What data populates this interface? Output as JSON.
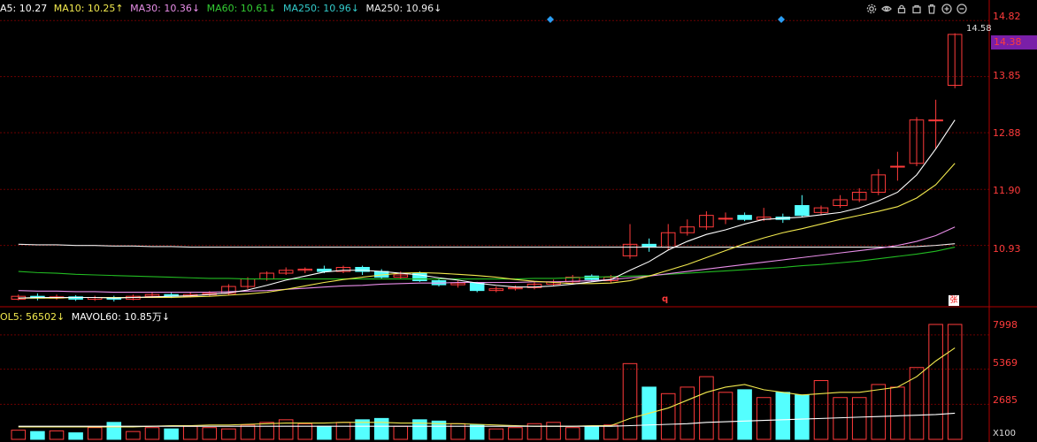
{
  "ma_legend": [
    {
      "label": "A5: 10.27",
      "color": "#ffffff"
    },
    {
      "label": "MA10: 10.25↑",
      "color": "#f2e94e"
    },
    {
      "label": "MA30: 10.36↓",
      "color": "#e88ee8"
    },
    {
      "label": "MA60: 10.61↓",
      "color": "#33cc33"
    },
    {
      "label": "MA250: 10.96↓",
      "color": "#33cccc"
    },
    {
      "label": "MA250: 10.96↓",
      "color": "#eeeeee"
    }
  ],
  "vol_legend": [
    {
      "label": "OL5: 56502↓",
      "color": "#f2e94e"
    },
    {
      "label": "MAVOL60: 10.85万↓",
      "color": "#ffffff"
    }
  ],
  "toolbar_icons": [
    "settings-icon",
    "eye-icon",
    "lock-icon",
    "bag-icon",
    "trash-icon",
    "zoom-in-icon",
    "zoom-out-icon"
  ],
  "price_axis": [
    "14.82",
    "13.85",
    "12.88",
    "11.90",
    "10.93"
  ],
  "current_price": "14.38",
  "high_label": "14.58",
  "volume_axis": [
    "7998",
    "5369",
    "2685"
  ],
  "volume_unit": "X100",
  "marker_q": "q",
  "badge_text": "张",
  "colors": {
    "up": "#ff3b3b",
    "down": "#54ffff",
    "grid": "#6b0000"
  },
  "chart_data": {
    "type": "candlestick",
    "ylim": [
      9.9,
      14.9
    ],
    "candles": [
      [
        10.0,
        10.05,
        10.08,
        9.98
      ],
      [
        10.05,
        10.02,
        10.1,
        9.98
      ],
      [
        10.02,
        10.04,
        10.08,
        9.99
      ],
      [
        10.04,
        10.0,
        10.07,
        9.97
      ],
      [
        10.0,
        10.03,
        10.06,
        9.97
      ],
      [
        10.03,
        10.0,
        10.06,
        9.96
      ],
      [
        10.0,
        10.05,
        10.08,
        9.98
      ],
      [
        10.05,
        10.08,
        10.12,
        10.02
      ],
      [
        10.08,
        10.05,
        10.11,
        10.02
      ],
      [
        10.05,
        10.08,
        10.12,
        10.03
      ],
      [
        10.08,
        10.1,
        10.14,
        10.05
      ],
      [
        10.1,
        10.22,
        10.26,
        10.07
      ],
      [
        10.22,
        10.35,
        10.38,
        10.18
      ],
      [
        10.35,
        10.45,
        10.48,
        10.32
      ],
      [
        10.45,
        10.5,
        10.55,
        10.42
      ],
      [
        10.5,
        10.52,
        10.55,
        10.45
      ],
      [
        10.52,
        10.48,
        10.58,
        10.45
      ],
      [
        10.48,
        10.55,
        10.58,
        10.45
      ],
      [
        10.55,
        10.48,
        10.58,
        10.42
      ],
      [
        10.48,
        10.38,
        10.52,
        10.35
      ],
      [
        10.38,
        10.42,
        10.48,
        10.35
      ],
      [
        10.45,
        10.32,
        10.48,
        10.3
      ],
      [
        10.32,
        10.25,
        10.35,
        10.22
      ],
      [
        10.25,
        10.28,
        10.32,
        10.2
      ],
      [
        10.28,
        10.15,
        10.3,
        10.12
      ],
      [
        10.15,
        10.18,
        10.22,
        10.12
      ],
      [
        10.18,
        10.2,
        10.24,
        10.15
      ],
      [
        10.2,
        10.26,
        10.3,
        10.17
      ],
      [
        10.26,
        10.3,
        10.34,
        10.22
      ],
      [
        10.3,
        10.38,
        10.42,
        10.26
      ],
      [
        10.4,
        10.34,
        10.43,
        10.3
      ],
      [
        10.32,
        10.38,
        10.42,
        10.28
      ],
      [
        10.75,
        10.95,
        11.3,
        10.7
      ],
      [
        10.95,
        10.9,
        11.05,
        10.82
      ],
      [
        10.9,
        11.15,
        11.3,
        10.85
      ],
      [
        11.15,
        11.25,
        11.38,
        11.1
      ],
      [
        11.25,
        11.45,
        11.52,
        11.2
      ],
      [
        11.4,
        11.4,
        11.5,
        11.3
      ],
      [
        11.45,
        11.38,
        11.5,
        11.35
      ],
      [
        11.38,
        11.42,
        11.58,
        11.35
      ],
      [
        11.42,
        11.38,
        11.48,
        11.32
      ],
      [
        11.62,
        11.45,
        11.8,
        11.42
      ],
      [
        11.5,
        11.58,
        11.62,
        11.45
      ],
      [
        11.62,
        11.72,
        11.8,
        11.58
      ],
      [
        11.72,
        11.85,
        11.92,
        11.68
      ],
      [
        11.85,
        12.15,
        12.25,
        11.8
      ],
      [
        12.3,
        12.3,
        12.55,
        12.05
      ],
      [
        12.35,
        13.1,
        13.15,
        12.3
      ],
      [
        13.1,
        13.1,
        13.45,
        12.6
      ],
      [
        13.7,
        14.58,
        14.6,
        13.65
      ]
    ],
    "volumes": [
      700,
      600,
      650,
      500,
      900,
      1300,
      600,
      900,
      800,
      1000,
      900,
      800,
      1100,
      1300,
      1500,
      1200,
      1000,
      1300,
      1500,
      1600,
      1000,
      1500,
      1400,
      1200,
      1100,
      800,
      900,
      1200,
      1300,
      900,
      1000,
      1100,
      5800,
      4000,
      3500,
      4000,
      4800,
      3600,
      3800,
      3200,
      3600,
      3400,
      4500,
      3200,
      3200,
      4200,
      4000,
      5500,
      8800,
      8800
    ],
    "mavol5": [
      950,
      950,
      950,
      950,
      950,
      950,
      950,
      1000,
      1050,
      1050,
      1100,
      1100,
      1150,
      1200,
      1250,
      1250,
      1250,
      1300,
      1300,
      1300,
      1250,
      1250,
      1200,
      1200,
      1150,
      1100,
      1050,
      1000,
      1000,
      1000,
      1050,
      1050,
      1600,
      2000,
      2400,
      3000,
      3600,
      4000,
      4200,
      3800,
      3600,
      3400,
      3500,
      3600,
      3600,
      3800,
      4000,
      4800,
      6000,
      7000
    ],
    "mavol60": [
      1000,
      1000,
      1000,
      1000,
      1000,
      1000,
      1000,
      1000,
      1000,
      1000,
      1000,
      1000,
      1000,
      1000,
      1000,
      1000,
      1000,
      1000,
      1000,
      1000,
      1000,
      1000,
      1000,
      1000,
      1000,
      1000,
      1000,
      1000,
      1000,
      1000,
      1000,
      1000,
      1050,
      1100,
      1150,
      1200,
      1300,
      1350,
      1400,
      1450,
      1500,
      1550,
      1600,
      1650,
      1700,
      1750,
      1800,
      1850,
      1900,
      2000
    ],
    "vol_ylim": [
      0,
      8800
    ],
    "ma5": [
      10.02,
      10.03,
      10.03,
      10.03,
      10.03,
      10.02,
      10.03,
      10.04,
      10.05,
      10.06,
      10.08,
      10.11,
      10.16,
      10.24,
      10.33,
      10.4,
      10.47,
      10.5,
      10.5,
      10.48,
      10.45,
      10.42,
      10.37,
      10.33,
      10.28,
      10.24,
      10.21,
      10.21,
      10.23,
      10.26,
      10.3,
      10.34,
      10.5,
      10.65,
      10.85,
      11.0,
      11.12,
      11.2,
      11.3,
      11.38,
      11.4,
      11.42,
      11.46,
      11.5,
      11.58,
      11.7,
      11.85,
      12.15,
      12.6,
      13.1
    ],
    "ma10": [
      10.02,
      10.02,
      10.02,
      10.03,
      10.03,
      10.03,
      10.03,
      10.03,
      10.03,
      10.04,
      10.05,
      10.07,
      10.09,
      10.12,
      10.17,
      10.23,
      10.29,
      10.34,
      10.38,
      10.42,
      10.45,
      10.46,
      10.45,
      10.43,
      10.41,
      10.38,
      10.34,
      10.31,
      10.29,
      10.27,
      10.27,
      10.28,
      10.32,
      10.4,
      10.5,
      10.6,
      10.72,
      10.84,
      10.96,
      11.06,
      11.15,
      11.22,
      11.3,
      11.38,
      11.45,
      11.52,
      11.6,
      11.75,
      11.98,
      12.35
    ],
    "ma30": [
      10.15,
      10.14,
      10.14,
      10.13,
      10.13,
      10.12,
      10.12,
      10.12,
      10.12,
      10.12,
      10.12,
      10.13,
      10.14,
      10.15,
      10.17,
      10.19,
      10.21,
      10.23,
      10.24,
      10.26,
      10.27,
      10.28,
      10.28,
      10.29,
      10.29,
      10.29,
      10.29,
      10.3,
      10.3,
      10.31,
      10.32,
      10.34,
      10.37,
      10.4,
      10.44,
      10.48,
      10.52,
      10.56,
      10.6,
      10.64,
      10.68,
      10.72,
      10.76,
      10.8,
      10.84,
      10.88,
      10.93,
      11.0,
      11.1,
      11.25
    ],
    "ma60": [
      10.48,
      10.46,
      10.45,
      10.43,
      10.42,
      10.41,
      10.4,
      10.39,
      10.38,
      10.37,
      10.36,
      10.36,
      10.35,
      10.35,
      10.35,
      10.35,
      10.35,
      10.35,
      10.35,
      10.35,
      10.35,
      10.35,
      10.35,
      10.35,
      10.35,
      10.35,
      10.35,
      10.36,
      10.36,
      10.37,
      10.38,
      10.39,
      10.4,
      10.41,
      10.43,
      10.45,
      10.47,
      10.49,
      10.51,
      10.53,
      10.55,
      10.58,
      10.6,
      10.63,
      10.66,
      10.7,
      10.74,
      10.78,
      10.83,
      10.9
    ],
    "ma250": [
      10.95,
      10.94,
      10.94,
      10.93,
      10.93,
      10.92,
      10.92,
      10.91,
      10.91,
      10.9,
      10.9,
      10.9,
      10.9,
      10.9,
      10.9,
      10.9,
      10.9,
      10.9,
      10.9,
      10.9,
      10.9,
      10.9,
      10.9,
      10.9,
      10.9,
      10.9,
      10.9,
      10.9,
      10.9,
      10.9,
      10.9,
      10.9,
      10.9,
      10.9,
      10.9,
      10.9,
      10.9,
      10.9,
      10.9,
      10.9,
      10.9,
      10.9,
      10.9,
      10.9,
      10.9,
      10.9,
      10.9,
      10.91,
      10.93,
      10.96
    ]
  }
}
